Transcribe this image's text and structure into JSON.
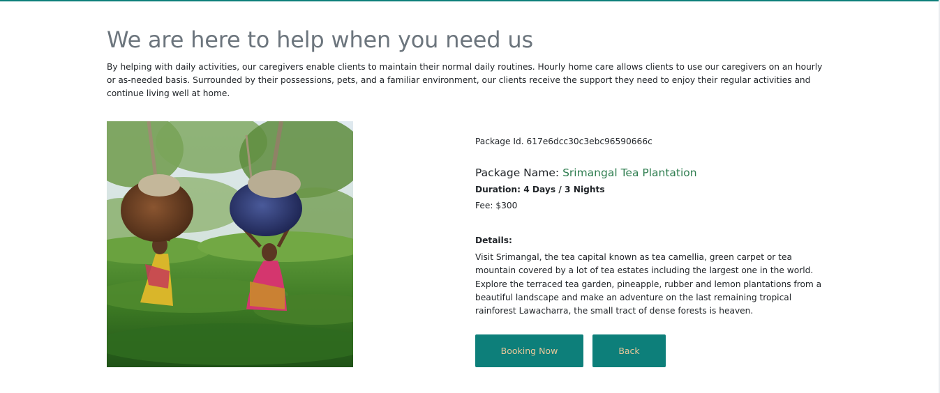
{
  "heading": "We are here to help when you need us",
  "intro": "By helping with daily activities, our caregivers enable clients to maintain their normal daily routines. Hourly home care allows clients to use our caregivers on an hourly or as-needed basis. Surrounded by their possessions, pets, and a familiar environment, our clients receive the support they need to enjoy their regular activities and continue living well at home.",
  "package": {
    "id_label": "Package Id.",
    "id_value": "617e6dcc30c3ebc96590666c",
    "name_label": "Package Name:",
    "name_value": "Srimangal Tea Plantation",
    "duration": "Duration: 4 Days / 3 Nights",
    "fee": "Fee: $300",
    "details_label": "Details:",
    "details_text": "Visit Srimangal, the tea capital known as tea camellia, green carpet or tea mountain covered by a lot of tea estates including the largest one in the world. Explore the terraced tea garden, pineapple, rubber and lemon plantations from a beautiful landscape and make an adventure on the last remaining tropical rainforest Lawacharra, the small tract of dense forests is heaven."
  },
  "buttons": {
    "booking": "Booking Now",
    "back": "Back"
  },
  "colors": {
    "accent": "#0d7f7a",
    "button_text": "#e8c79a",
    "package_name": "#2e7d4f",
    "heading": "#6c757d"
  }
}
